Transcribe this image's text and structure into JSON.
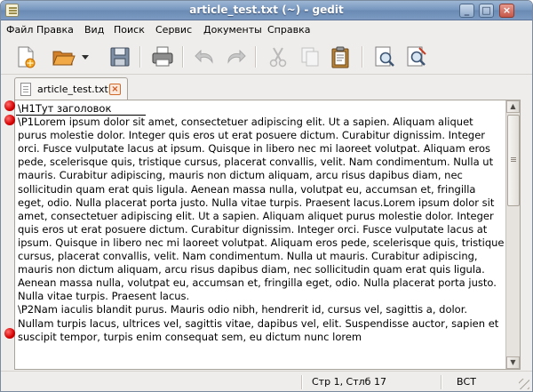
{
  "window": {
    "title": "article_test.txt (~) - gedit",
    "controls": {
      "minimize": "_",
      "maximize": "□",
      "close": "×"
    }
  },
  "menu": [
    "Файл",
    "Правка",
    "Вид",
    "Поиск",
    "Сервис",
    "Документы",
    "Справка"
  ],
  "toolbar": {
    "buttons": [
      "new-document-icon",
      "open-folder-icon",
      "dropdown-arrow-icon",
      "save-icon",
      "print-icon",
      "undo-icon",
      "redo-icon",
      "cut-icon",
      "copy-icon",
      "paste-icon",
      "find-icon",
      "find-replace-icon"
    ]
  },
  "tab": {
    "label": "article_test.txt",
    "close": "×"
  },
  "editor": {
    "content": "\\H1Тут заголовок\n\\P1Lorem ipsum dolor sit amet, consectetuer adipiscing elit. Ut a sapien. Aliquam aliquet purus molestie dolor. Integer quis eros ut erat posuere dictum. Curabitur dignissim. Integer orci. Fusce vulputate lacus at ipsum. Quisque in libero nec mi laoreet volutpat. Aliquam eros pede, scelerisque quis, tristique cursus, placerat convallis, velit. Nam condimentum. Nulla ut mauris. Curabitur adipiscing, mauris non dictum aliquam, arcu risus dapibus diam, nec sollicitudin quam erat quis ligula. Aenean massa nulla, volutpat eu, accumsan et, fringilla eget, odio. Nulla placerat porta justo. Nulla vitae turpis. Praesent lacus.Lorem ipsum dolor sit amet, consectetuer adipiscing elit. Ut a sapien. Aliquam aliquet purus molestie dolor. Integer quis eros ut erat posuere dictum. Curabitur dignissim. Integer orci. Fusce vulputate lacus at ipsum. Quisque in libero nec mi laoreet volutpat. Aliquam eros pede, scelerisque quis, tristique cursus, placerat convallis, velit. Nam condimentum. Nulla ut mauris. Curabitur adipiscing, mauris non dictum aliquam, arcu risus dapibus diam, nec sollicitudin quam erat quis ligula. Aenean massa nulla, volutpat eu, accumsan et, fringilla eget, odio. Nulla placerat porta justo. Nulla vitae turpis. Praesent lacus.\n\\P2Nam iaculis blandit purus. Mauris odio nibh, hendrerit id, cursus vel, sagittis a, dolor. Nullam turpis lacus, ultrices vel, sagittis vitae, dapibus vel, elit. Suspendisse auctor, sapien et suscipit tempor, turpis enim consequat sem, eu dictum nunc lorem"
  },
  "status": {
    "position": "Стр 1, Стлб 17",
    "mode": "ВСТ"
  },
  "colors": {
    "titlebar": "#7595be",
    "marker": "#d40000",
    "tab_close": "#d0551c"
  }
}
